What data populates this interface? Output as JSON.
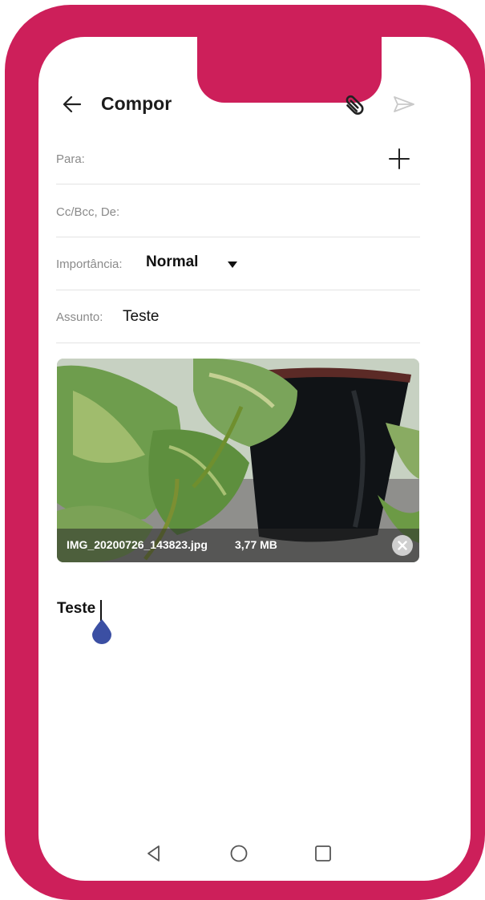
{
  "colors": {
    "frame": "#cd1f5a",
    "text_primary": "#1c1c1c",
    "label": "#8a8a8a",
    "divider": "#e3e3e3",
    "cursor_handle": "#3b4fa3"
  },
  "header": {
    "title": "Compor",
    "back_icon": "arrow-left-icon",
    "attach_icon": "paperclip-icon",
    "send_icon": "send-icon"
  },
  "fields": {
    "to": {
      "label": "Para:",
      "add_icon": "plus-icon"
    },
    "cc": {
      "label": "Cc/Bcc, De:"
    },
    "importance": {
      "label": "Importância:",
      "value": "Normal",
      "dropdown_icon": "caret-down-icon"
    },
    "subject": {
      "label": "Assunto:",
      "value": "Teste"
    }
  },
  "attachment": {
    "file_name": "IMG_20200726_143823.jpg",
    "file_size": "3,77 MB",
    "remove_icon": "close-circle-icon"
  },
  "body": {
    "text": "Teste"
  },
  "navbar": {
    "back_icon": "nav-back-triangle-icon",
    "home_icon": "nav-home-circle-icon",
    "recents_icon": "nav-recents-square-icon"
  }
}
